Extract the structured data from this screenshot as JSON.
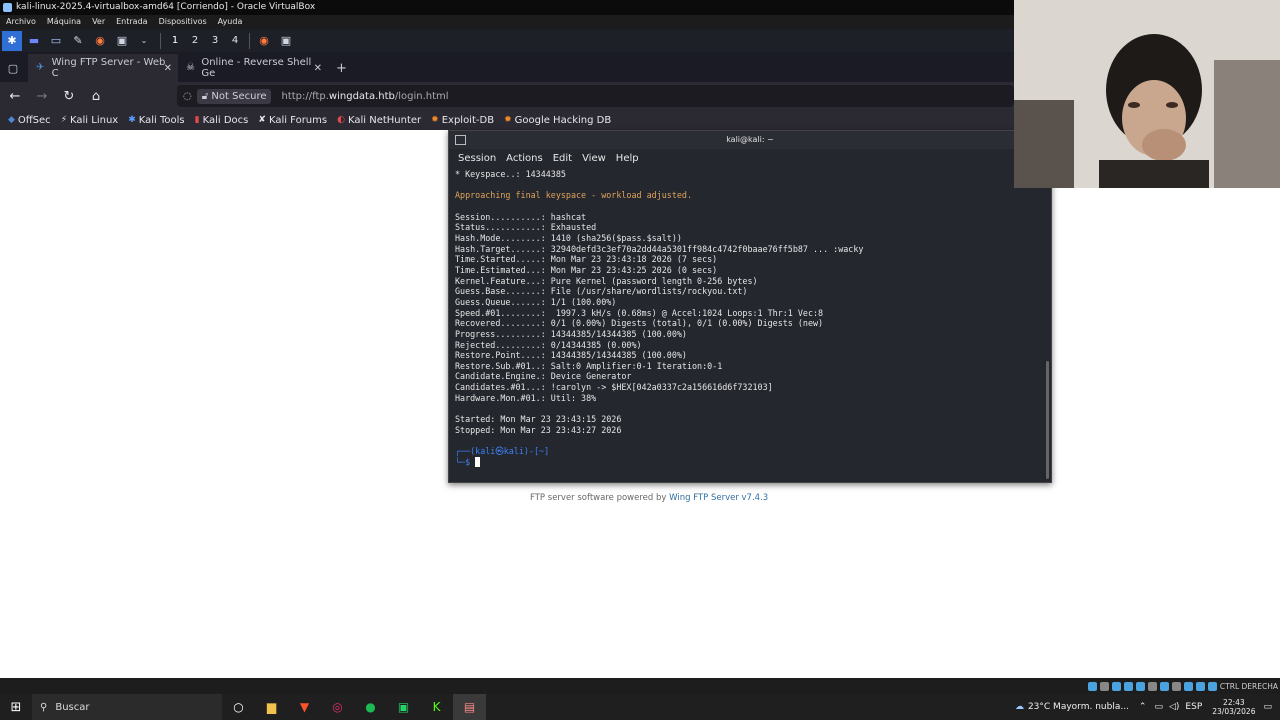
{
  "vbox": {
    "title": "kali-linux-2025.4-virtualbox-amd64 [Corriendo] - Oracle VirtualBox",
    "menu": [
      "Archivo",
      "Máquina",
      "Ver",
      "Entrada",
      "Dispositivos",
      "Ayuda"
    ],
    "host_key": "CTRL DERECHA"
  },
  "panel": {
    "workspaces": [
      "1",
      "2",
      "3",
      "4"
    ]
  },
  "browser": {
    "tabs": [
      {
        "label": "Wing FTP Server - Web C",
        "active": true
      },
      {
        "label": "Online - Reverse Shell Ge",
        "active": false
      }
    ],
    "security_label": "Not Secure",
    "url_prefix": "http://ftp.",
    "url_domain": "wingdata.htb",
    "url_suffix": "/login.html",
    "bookmarks": [
      "OffSec",
      "Kali Linux",
      "Kali Tools",
      "Kali Docs",
      "Kali Forums",
      "Kali NetHunter",
      "Exploit-DB",
      "Google Hacking DB"
    ]
  },
  "page": {
    "footer_prefix": "FTP server software powered by ",
    "footer_link": "Wing FTP Server v7.4.3"
  },
  "terminal": {
    "title": "kali@kali: ~",
    "menu": [
      "Session",
      "Actions",
      "Edit",
      "View",
      "Help"
    ],
    "keyspace_line": "* Keyspace..: 14344385",
    "warning_line": "Approaching final keyspace - workload adjusted.",
    "lines": [
      "Session..........: hashcat",
      "Status...........: Exhausted",
      "Hash.Mode........: 1410 (sha256($pass.$salt))",
      "Hash.Target......: 32940defd3c3ef70a2dd44a5301ff984c4742f0baae76ff5b87 ... :wacky",
      "Time.Started.....: Mon Mar 23 23:43:18 2026 (7 secs)",
      "Time.Estimated...: Mon Mar 23 23:43:25 2026 (0 secs)",
      "Kernel.Feature...: Pure Kernel (password length 0-256 bytes)",
      "Guess.Base.......: File (/usr/share/wordlists/rockyou.txt)",
      "Guess.Queue......: 1/1 (100.00%)",
      "Speed.#01........:  1997.3 kH/s (0.68ms) @ Accel:1024 Loops:1 Thr:1 Vec:8",
      "Recovered........: 0/1 (0.00%) Digests (total), 0/1 (0.00%) Digests (new)",
      "Progress.........: 14344385/14344385 (100.00%)",
      "Rejected.........: 0/14344385 (0.00%)",
      "Restore.Point....: 14344385/14344385 (100.00%)",
      "Restore.Sub.#01..: Salt:0 Amplifier:0-1 Iteration:0-1",
      "Candidate.Engine.: Device Generator",
      "Candidates.#01...: !carolyn -> $HEX[042a0337c2a156616d6f732103]",
      "Hardware.Mon.#01.: Util: 38%"
    ],
    "started_line": "Started: Mon Mar 23 23:43:15 2026",
    "stopped_line": "Stopped: Mon Mar 23 23:43:27 2026",
    "prompt_user": "(kali㉿kali)-[~]",
    "prompt_symbol": "$"
  },
  "taskbar": {
    "search_placeholder": "Buscar",
    "weather": "23°C  Mayorm. nubla...",
    "lang": "ESP",
    "time": "22:43",
    "date": "23/03/2026"
  }
}
